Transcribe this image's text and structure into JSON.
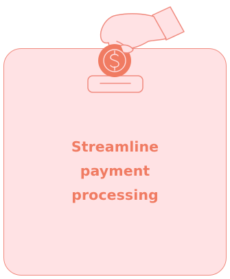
{
  "feature": {
    "line1": "Streamline",
    "line2": "payment",
    "line3": "processing"
  },
  "icons": {
    "illustration": "hand-dropping-coin-icon",
    "coin": "dollar-coin-icon",
    "slot": "payment-slot-icon"
  },
  "colors": {
    "card_bg": "#ffe2e4",
    "card_border": "#f08a7e",
    "accent": "#f07b62",
    "coin": "#f07b62"
  }
}
